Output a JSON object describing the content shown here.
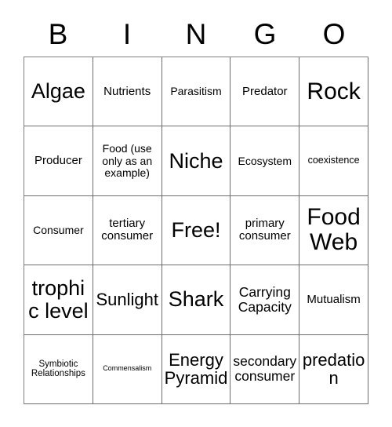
{
  "header": {
    "letters": [
      "B",
      "I",
      "N",
      "G",
      "O"
    ]
  },
  "grid": {
    "columns": 5,
    "rows": 5,
    "cells": [
      {
        "text": "Algae",
        "size": "s-xxl"
      },
      {
        "text": "Nutrients",
        "size": "s-mdl"
      },
      {
        "text": "Parasitism",
        "size": "s-md"
      },
      {
        "text": "Predator",
        "size": "s-mdl"
      },
      {
        "text": "Rock",
        "size": "s-xxxl"
      },
      {
        "text": "Producer",
        "size": "s-mdl"
      },
      {
        "text": "Food (use only as an example)",
        "size": "s-md"
      },
      {
        "text": "Niche",
        "size": "s-xxl"
      },
      {
        "text": "Ecosystem",
        "size": "s-md"
      },
      {
        "text": "coexistence",
        "size": "s-smm"
      },
      {
        "text": "Consumer",
        "size": "s-md"
      },
      {
        "text": "tertiary consumer",
        "size": "s-mdl"
      },
      {
        "text": "Free!",
        "size": "s-xxl"
      },
      {
        "text": "primary consumer",
        "size": "s-mdl"
      },
      {
        "text": "Food Web",
        "size": "s-xxxl"
      },
      {
        "text": "trophic level",
        "size": "s-xxl"
      },
      {
        "text": "Sunlight",
        "size": "s-xl"
      },
      {
        "text": "Shark",
        "size": "s-xxl"
      },
      {
        "text": "Carrying Capacity",
        "size": "s-lg"
      },
      {
        "text": "Mutualism",
        "size": "s-mdl"
      },
      {
        "text": "Symbiotic Relationships",
        "size": "s-sm"
      },
      {
        "text": "Commensalism",
        "size": "s-xs"
      },
      {
        "text": "Energy Pyramid",
        "size": "s-xl"
      },
      {
        "text": "secondary consumer",
        "size": "s-lg"
      },
      {
        "text": "predation",
        "size": "s-xl"
      }
    ]
  },
  "colors": {
    "background": "#ffffff",
    "text": "#000000",
    "grid_line": "#6e6e6e"
  }
}
